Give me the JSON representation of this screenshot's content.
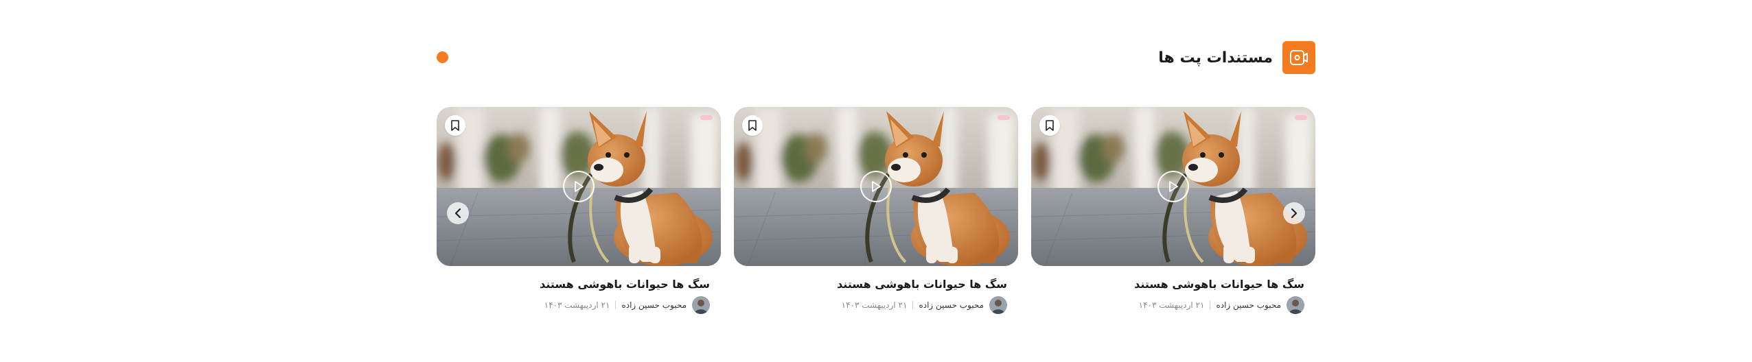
{
  "section": {
    "title": "مستندات پت ها",
    "icon": "video-camera-icon",
    "accent_color": "#f47b20"
  },
  "cards": [
    {
      "title": "سگ ها حیوانات باهوشی هستند",
      "author": "محبوب حسین زاده",
      "date": "۲۱ اردیبهشت ۱۴۰۳",
      "image": "corgi-with-leash-photo"
    },
    {
      "title": "سگ ها حیوانات باهوشی هستند",
      "author": "محبوب حسین زاده",
      "date": "۲۱ اردیبهشت ۱۴۰۳",
      "image": "corgi-with-leash-photo"
    },
    {
      "title": "سگ ها حیوانات باهوشی هستند",
      "author": "محبوب حسین زاده",
      "date": "۲۱ اردیبهشت ۱۴۰۳",
      "image": "corgi-with-leash-photo"
    }
  ],
  "controls": {
    "prev_icon": "chevron-left-icon",
    "next_icon": "chevron-right-icon",
    "play_icon": "play-icon",
    "bookmark_icon": "bookmark-icon"
  }
}
